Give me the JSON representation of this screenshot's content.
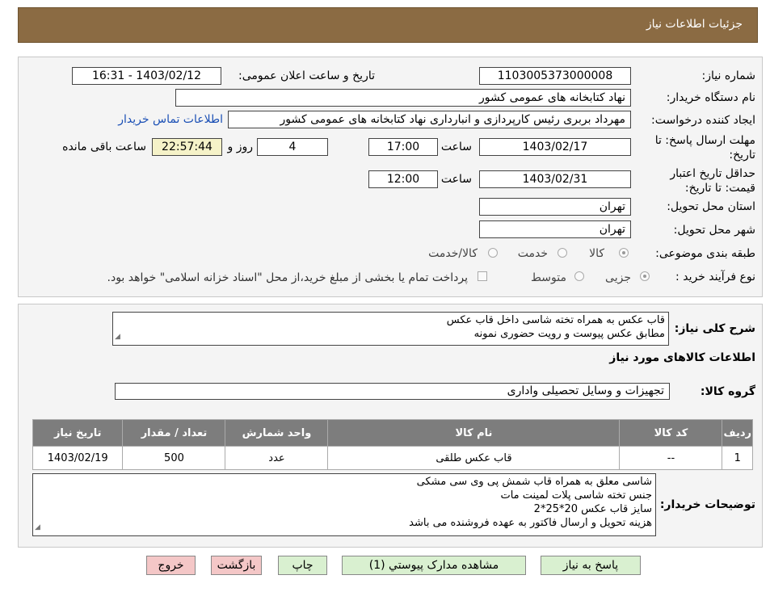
{
  "header": {
    "title": "جزئیات اطلاعات نیاز"
  },
  "form": {
    "need_number_label": "شماره نیاز:",
    "need_number": "1103005373000008",
    "announce_label": "تاریخ و ساعت اعلان عمومی:",
    "announce_value": "1403/02/12 - 16:31",
    "buyer_org_label": "نام دستگاه خریدار:",
    "buyer_org": "نهاد کتابخانه های عمومی کشور",
    "creator_label": "ایجاد کننده درخواست:",
    "creator": "مهرداد بربری رئیس کارپردازی و انبارداری نهاد کتابخانه های عمومی کشور",
    "contact_link": "اطلاعات تماس خریدار",
    "reply_deadline_label_1": "مهلت ارسال پاسخ: تا",
    "reply_deadline_label_2": "تاریخ:",
    "reply_date": "1403/02/17",
    "time_label": "ساعت",
    "reply_time": "17:00",
    "days_value": "4",
    "days_label": "روز و",
    "remaining_time": "22:57:44",
    "remaining_label": "ساعت باقی مانده",
    "validity_label_1": "حداقل تاریخ اعتبار",
    "validity_label_2": "قیمت: تا تاریخ:",
    "validity_date": "1403/02/31",
    "validity_time": "12:00",
    "province_label": "استان محل تحویل:",
    "province": "تهران",
    "city_label": "شهر محل تحویل:",
    "city": "تهران",
    "category_label": "طبقه بندی موضوعی:",
    "category_options": [
      "کالا",
      "خدمت",
      "کالا/خدمت"
    ],
    "process_label": "نوع فرآیند خرید :",
    "process_options": [
      "جزیی",
      "متوسط"
    ],
    "payment_note": "پرداخت تمام یا بخشی از مبلغ خرید،از محل \"اسناد خزانه اسلامی\" خواهد بود."
  },
  "description": {
    "label": "شرح کلی نیاز:",
    "lines": [
      "قاب عکس به همراه تخته شاسی داخل قاب عکس",
      "مطابق عکس پیوست و رویت حضوری نمونه"
    ]
  },
  "goods": {
    "section_title": "اطلاعات کالاهای مورد نیاز",
    "group_label": "گروه کالا:",
    "group_value": "تجهیزات و وسایل تحصیلی واداری",
    "columns": [
      "ردیف",
      "کد کالا",
      "نام کالا",
      "واحد شمارش",
      "تعداد / مقدار",
      "تاریخ نیاز"
    ],
    "rows": [
      [
        "1",
        "--",
        "قاب عکس طلقی",
        "عدد",
        "500",
        "1403/02/19"
      ]
    ]
  },
  "buyer_notes": {
    "label": "توضیحات خریدار:",
    "lines": [
      "شاسی معلق به همراه قاب شمش پی وی سی مشکی",
      "جنس تخته شاسی پلات لمینت مات",
      "سایز قاب عکس 20*25*2",
      "هزینه تحویل و ارسال فاکتور به عهده فروشنده می باشد"
    ]
  },
  "buttons": {
    "reply": "پاسخ به نیاز",
    "attachments": "مشاهده مدارک پیوستي (1)",
    "print": "چاپ",
    "back": "بازگشت",
    "exit": "خروج"
  },
  "colors": {
    "header_bg": "#8b6b43",
    "table_header_bg": "#7d7d7d",
    "button_green": "#d9f0d0",
    "button_pink": "#f4c7c7"
  }
}
